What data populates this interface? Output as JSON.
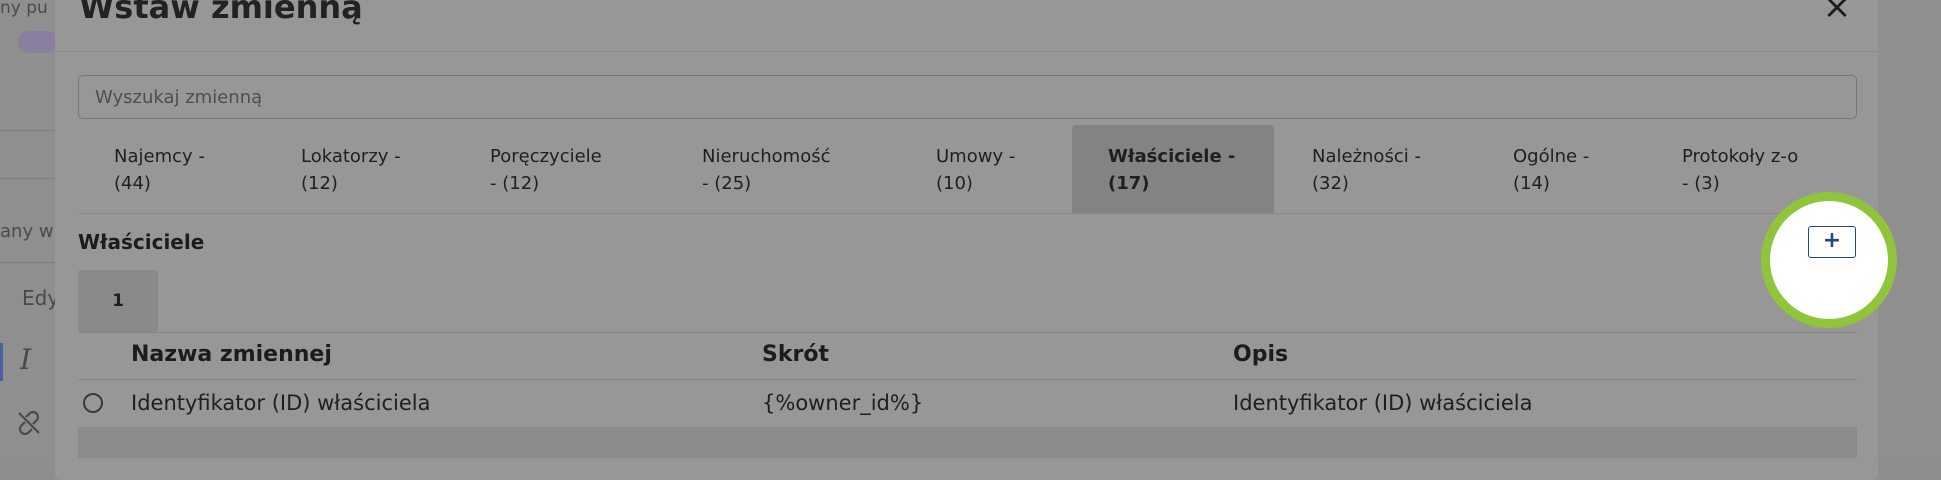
{
  "background": {
    "fragments": {
      "top": "ny pu",
      "middle": "any w",
      "edit": "Edy"
    }
  },
  "modal": {
    "title": "Wstaw zmienną",
    "close": "×",
    "search": {
      "placeholder": "Wyszukaj zmienną",
      "value": ""
    },
    "tabs": [
      {
        "line1": "Najemcy -",
        "line2": "(44)"
      },
      {
        "line1": "Lokatorzy -",
        "line2": "(12)"
      },
      {
        "line1": "Poręczyciele",
        "line2": "- (12)"
      },
      {
        "line1": "Nieruchomość",
        "line2": "- (25)"
      },
      {
        "line1": "Umowy -",
        "line2": "(10)"
      },
      {
        "line1": "Właściciele -",
        "line2": "(17)"
      },
      {
        "line1": "Należności -",
        "line2": "(32)"
      },
      {
        "line1": "Ogólne -",
        "line2": "(14)"
      },
      {
        "line1": "Protokoły z-o",
        "line2": "- (3)"
      }
    ],
    "active_tab": "Właściciele",
    "section_title": "Właściciele",
    "page_number": "1",
    "add_button": "+",
    "table": {
      "columns": [
        "Nazwa zmiennej",
        "Skrót",
        "Opis"
      ],
      "rows": [
        {
          "name": "Identyfikator (ID) właściciela",
          "shortcut": "{%owner_id%}",
          "description": "Identyfikator (ID) właściciela"
        }
      ]
    }
  },
  "colors": {
    "highlight": "#8fc43b",
    "accent": "#27448a"
  }
}
